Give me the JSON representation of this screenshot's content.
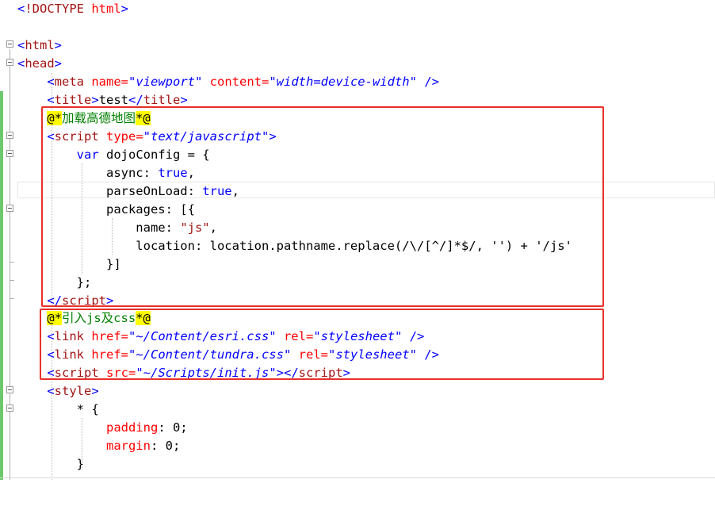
{
  "lines": [
    [
      "<",
      "!DOCTYPE",
      " html",
      ">"
    ],
    [],
    [
      "<",
      "html",
      ">"
    ],
    [
      "<",
      "head",
      ">"
    ],
    [
      "    <",
      "meta",
      " name=",
      "\"viewport\"",
      " content=",
      "\"width=device-width\"",
      " />"
    ],
    [
      "    <",
      "title",
      ">",
      "test",
      "</",
      "title",
      ">"
    ],
    [
      "    ",
      "@*",
      "加载高德地图",
      "*@"
    ],
    [
      "    <",
      "script",
      " type=",
      "\"text/javascript\"",
      ">"
    ],
    [
      "        ",
      "var",
      " dojoConfig = {"
    ],
    [
      "            async: ",
      "true",
      ","
    ],
    [
      "            parseOnLoad: ",
      "true",
      ","
    ],
    [
      "            packages: [{"
    ],
    [
      "                name: ",
      "\"js\"",
      ","
    ],
    [
      "                location: location.pathname.replace(/\\/[^/]*$/, '') + '/js'"
    ],
    [
      "            }]"
    ],
    [
      "        };"
    ],
    [
      "    </",
      "script",
      ">"
    ],
    [
      "    ",
      "@*",
      "引入js及css",
      "*@"
    ],
    [
      "    <",
      "link",
      " href=",
      "\"~/Content/esri.css\"",
      " rel=",
      "\"stylesheet\"",
      " />"
    ],
    [
      "    <",
      "link",
      " href=",
      "\"~/Content/tundra.css\"",
      " rel=",
      "\"stylesheet\"",
      " />"
    ],
    [
      "    <",
      "script",
      " src=",
      "\"~/Scripts/init.js\"",
      "></",
      "script",
      ">"
    ],
    [
      "    <",
      "style",
      ">"
    ],
    [
      "        * {"
    ],
    [
      "            padding",
      ": 0;"
    ],
    [
      "            margin",
      ": 0;"
    ],
    [
      "        }"
    ]
  ],
  "annotation": {
    "box_colour": "#e8302a",
    "gutter_colour": "#6cc86c"
  }
}
